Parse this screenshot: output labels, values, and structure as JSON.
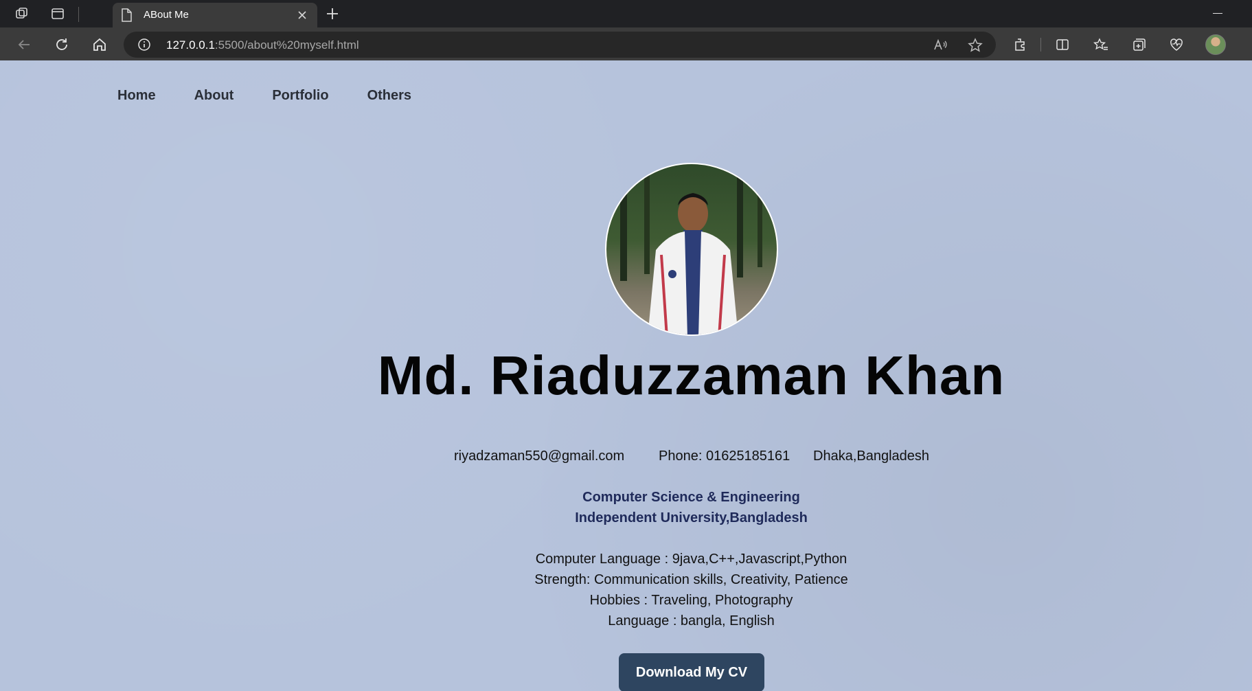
{
  "browser": {
    "tab_title": "ABout Me",
    "url_host": "127.0.0.1",
    "url_rest": ":5500/about%20myself.html"
  },
  "nav": {
    "items": [
      "Home",
      "About",
      "Portfolio",
      "Others"
    ]
  },
  "profile": {
    "name": "Md. Riaduzzaman Khan",
    "email": "riyadzaman550@gmail.com",
    "phone": "Phone: 01625185161",
    "location": "Dhaka,Bangladesh",
    "department": "Computer Science & Engineering",
    "university": "Independent University,Bangladesh",
    "details": [
      "Computer Language : 9java,C++,Javascript,Python",
      "Strength: Communication skills, Creativity, Patience",
      "Hobbies : Traveling, Photography",
      "Language : bangla, English"
    ],
    "cv_button": "Download My CV"
  },
  "colors": {
    "page_background": "#b6c3dc",
    "button_background": "#2e4560",
    "education_text": "#1f2a5a"
  }
}
